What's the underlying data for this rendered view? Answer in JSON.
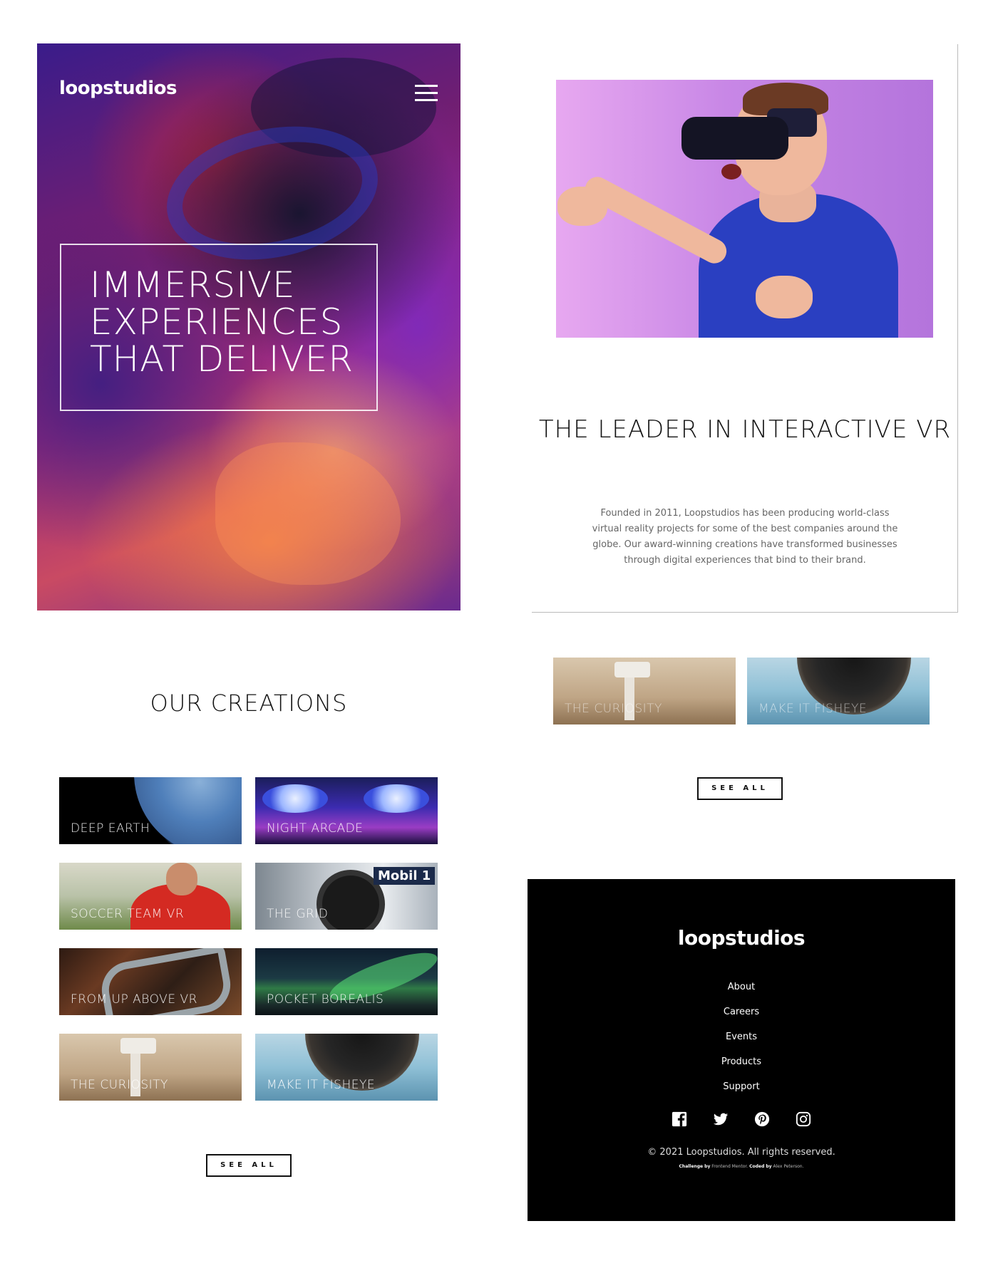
{
  "hero": {
    "logo": "loopstudios",
    "menu_icon": "hamburger-menu-icon",
    "title": "IMMERSIVE EXPERIENCES THAT DELIVER"
  },
  "about": {
    "title": "THE LEADER IN INTERACTIVE VR",
    "text": "Founded in 2011, Loopstudios has been producing world-class virtual reality projects for some of the best companies around the globe. Our award-winning creations have transformed businesses through digital experiences that bind to their brand."
  },
  "preview_cards": [
    {
      "label": "THE CURIOSITY"
    },
    {
      "label": "MAKE IT FISHEYE"
    }
  ],
  "creations": {
    "title": "OUR CREATIONS",
    "items": [
      {
        "label": "DEEP EARTH"
      },
      {
        "label": "NIGHT ARCADE"
      },
      {
        "label": "SOCCER TEAM VR"
      },
      {
        "label": "THE GRID"
      },
      {
        "label": "FROM UP ABOVE VR"
      },
      {
        "label": "POCKET BOREALIS"
      },
      {
        "label": "THE CURIOSITY"
      },
      {
        "label": "MAKE IT FISHEYE"
      }
    ],
    "see_all": "SEE ALL"
  },
  "preview_see_all": "SEE ALL",
  "footer": {
    "logo": "loopstudios",
    "nav": [
      "About",
      "Careers",
      "Events",
      "Products",
      "Support"
    ],
    "social_icons": [
      "facebook-icon",
      "twitter-icon",
      "pinterest-icon",
      "instagram-icon"
    ],
    "copyright": "© 2021 Loopstudios. All rights reserved.",
    "credit_label_1": "Challenge by",
    "credit_value_1": "Frontend Mentor",
    "credit_label_2": "Coded by",
    "credit_value_2": "Alex Peterson"
  }
}
